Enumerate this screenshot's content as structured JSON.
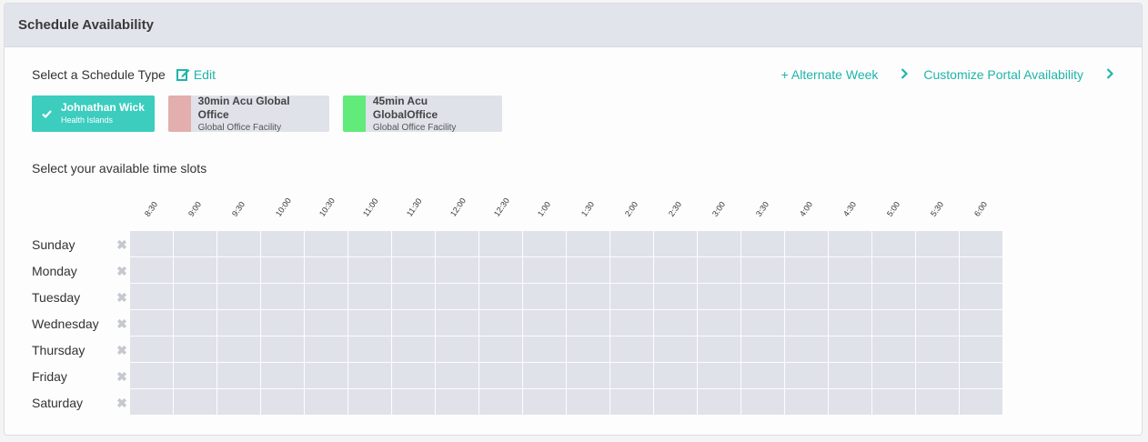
{
  "header": {
    "title": "Schedule Availability"
  },
  "schedule_type": {
    "label": "Select a Schedule Type",
    "edit_label": "Edit",
    "alternate_week": "+ Alternate Week",
    "customize_portal": "Customize Portal Availability",
    "types": [
      {
        "name": "Johnathan Wick",
        "sub": "Health Islands",
        "selected": true,
        "color": "#3ccdbf"
      },
      {
        "name": "30min Acu Global Office",
        "sub": "Global Office Facility",
        "selected": false,
        "color": "#e2aeae"
      },
      {
        "name": "45min Acu GlobalOffice",
        "sub": "Global Office Facility",
        "selected": false,
        "color": "#62ea7a"
      }
    ]
  },
  "slots": {
    "label": "Select your available time slots",
    "times": [
      "8:30",
      "9:00",
      "9:30",
      "10:00",
      "10:30",
      "11:00",
      "11:30",
      "12:00",
      "12:30",
      "1:00",
      "1:30",
      "2:00",
      "2:30",
      "3:00",
      "3:30",
      "4:00",
      "4:30",
      "5:00",
      "5:30",
      "6:00"
    ],
    "days": [
      "Sunday",
      "Monday",
      "Tuesday",
      "Wednesday",
      "Thursday",
      "Friday",
      "Saturday"
    ]
  },
  "colors": {
    "accent": "#1fb5a8",
    "cell": "#e0e2ea"
  }
}
